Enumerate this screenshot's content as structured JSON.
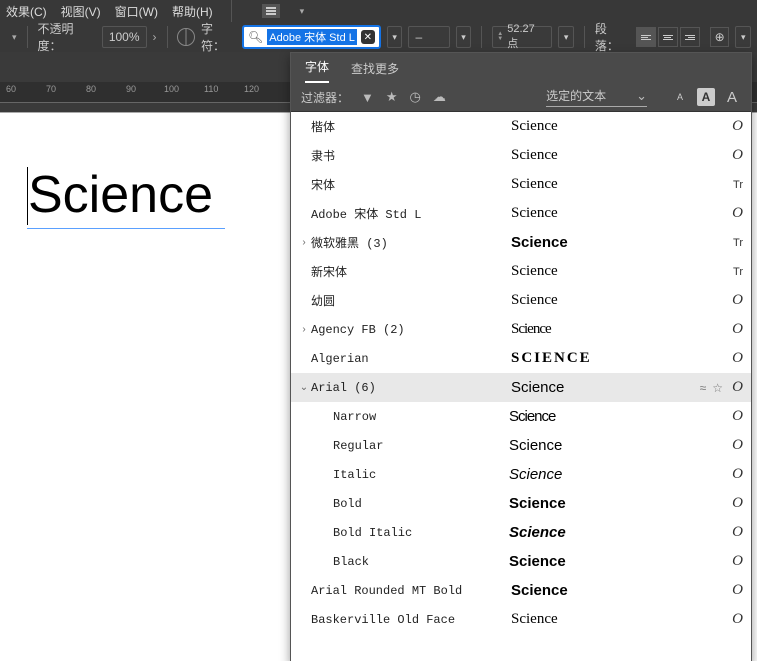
{
  "menu": {
    "effects": "效果(C)",
    "view": "视图(V)",
    "window": "窗口(W)",
    "help": "帮助(H)"
  },
  "options": {
    "opacity_label": "不透明度：",
    "opacity_value": "100%",
    "char_label": "字符：",
    "font_value": "Adobe 宋体 Std L",
    "dash": "–",
    "size_value": "52.27 点",
    "para_label": "段落："
  },
  "ruler_nums": [
    "60",
    "70",
    "80",
    "90",
    "100",
    "110",
    "120"
  ],
  "canvas_text": "Science",
  "panel": {
    "tab_font": "字体",
    "tab_find": "查找更多",
    "filter_label": "过滤器：",
    "selected_text": "选定的文本"
  },
  "fonts": [
    {
      "exp": "",
      "name": "楷体",
      "sample": "Science",
      "sample_style": "font-family:serif",
      "type": "O"
    },
    {
      "exp": "",
      "name": "隶书",
      "sample": "Science",
      "sample_style": "font-family:serif",
      "type": "O"
    },
    {
      "exp": "",
      "name": "宋体",
      "sample": "Science",
      "sample_style": "font-family:serif",
      "type": "Tr"
    },
    {
      "exp": "",
      "name": "Adobe 宋体 Std L",
      "sample": "Science",
      "sample_style": "font-family:serif",
      "type": "O"
    },
    {
      "exp": "›",
      "name": "微软雅黑 (3)",
      "sample": "Science",
      "sample_style": "font-family:Arial;font-weight:bold",
      "type": "Tr"
    },
    {
      "exp": "",
      "name": "新宋体",
      "sample": "Science",
      "sample_style": "font-family:serif",
      "type": "Tr"
    },
    {
      "exp": "",
      "name": "幼圆",
      "sample": "Science",
      "sample_style": "font-family:serif",
      "type": "O"
    },
    {
      "exp": "›",
      "name": "Agency FB (2)",
      "sample": "Science",
      "sample_style": "font-family:'Arial Narrow';letter-spacing:-1px",
      "type": "O"
    },
    {
      "exp": "",
      "name": "Algerian",
      "sample": "SCIENCE",
      "sample_style": "font-family:serif;font-weight:bold;letter-spacing:2px",
      "type": "O"
    },
    {
      "exp": "⌄",
      "name": "Arial (6)",
      "sample": "Science",
      "sample_style": "font-family:Arial",
      "type": "O",
      "active": true,
      "star": true
    },
    {
      "child": true,
      "name": "Narrow",
      "sample": "Science",
      "sample_style": "font-family:'Arial Narrow',Arial;letter-spacing:-1px",
      "type": "O"
    },
    {
      "child": true,
      "name": "Regular",
      "sample": "Science",
      "sample_style": "font-family:Arial",
      "type": "O"
    },
    {
      "child": true,
      "name": "Italic",
      "sample": "Science",
      "sample_style": "font-family:Arial;font-style:italic",
      "type": "O"
    },
    {
      "child": true,
      "name": "Bold",
      "sample": "Science",
      "sample_style": "font-family:Arial;font-weight:bold",
      "type": "O"
    },
    {
      "child": true,
      "name": "Bold Italic",
      "sample": "Science",
      "sample_style": "font-family:Arial;font-weight:bold;font-style:italic",
      "type": "O"
    },
    {
      "child": true,
      "name": "Black",
      "sample": "Science",
      "sample_style": "font-family:Arial;font-weight:900",
      "type": "O"
    },
    {
      "exp": "",
      "name": "Arial Rounded MT Bold",
      "sample": "Science",
      "sample_style": "font-family:Arial;font-weight:bold",
      "type": "O"
    },
    {
      "exp": "",
      "name": "Baskerville Old Face",
      "sample": "Science",
      "sample_style": "font-family:'Times New Roman',serif",
      "type": "O"
    }
  ],
  "chart_data": null
}
